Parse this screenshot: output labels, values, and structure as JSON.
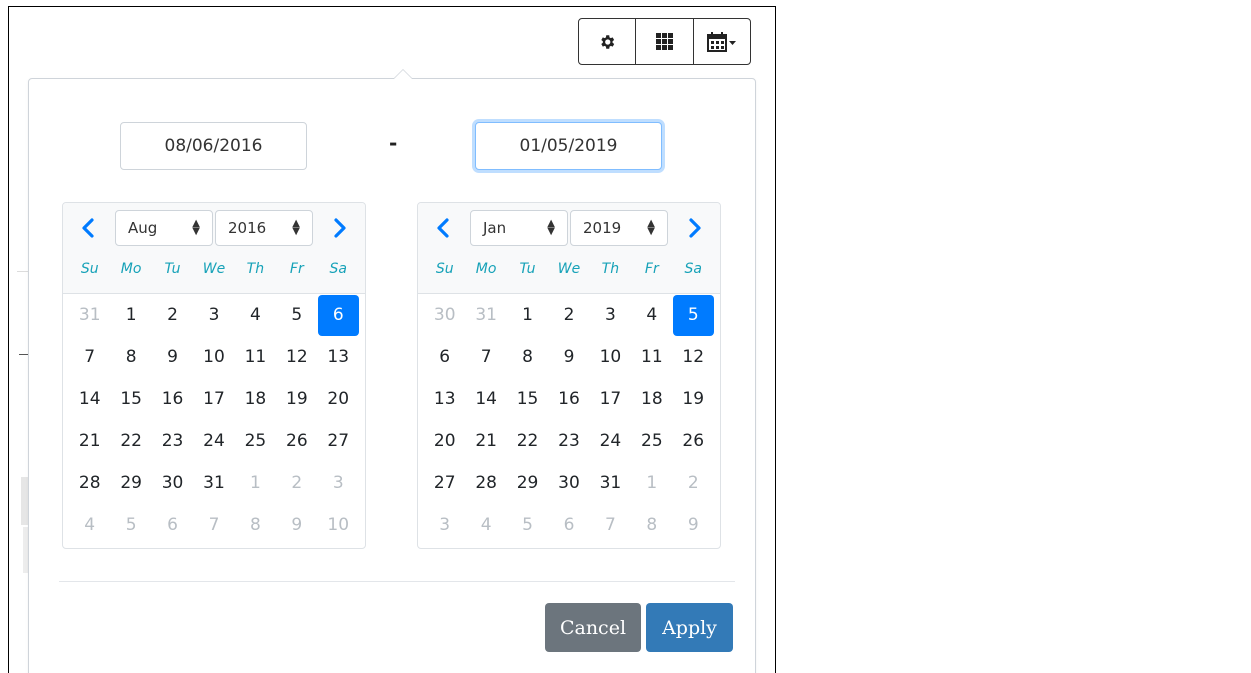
{
  "toolbar": {
    "icons": [
      "gear-icon",
      "grid-icon",
      "calendar-dropdown-icon"
    ]
  },
  "range": {
    "start_value": "08/06/2016",
    "separator": "-",
    "end_value": "01/05/2019"
  },
  "weekdays": [
    "Su",
    "Mo",
    "Tu",
    "We",
    "Th",
    "Fr",
    "Sa"
  ],
  "left_calendar": {
    "month": "Aug",
    "year": "2016",
    "weeks": [
      [
        "31",
        "1",
        "2",
        "3",
        "4",
        "5",
        "6"
      ],
      [
        "7",
        "8",
        "9",
        "10",
        "11",
        "12",
        "13"
      ],
      [
        "14",
        "15",
        "16",
        "17",
        "18",
        "19",
        "20"
      ],
      [
        "21",
        "22",
        "23",
        "24",
        "25",
        "26",
        "27"
      ],
      [
        "28",
        "29",
        "30",
        "31",
        "1",
        "2",
        "3"
      ],
      [
        "4",
        "5",
        "6",
        "7",
        "8",
        "9",
        "10"
      ]
    ],
    "muted": [
      [
        0,
        0
      ],
      [
        4,
        4
      ],
      [
        4,
        5
      ],
      [
        4,
        6
      ],
      [
        5,
        0
      ],
      [
        5,
        1
      ],
      [
        5,
        2
      ],
      [
        5,
        3
      ],
      [
        5,
        4
      ],
      [
        5,
        5
      ],
      [
        5,
        6
      ]
    ],
    "selected": [
      0,
      6
    ]
  },
  "right_calendar": {
    "month": "Jan",
    "year": "2019",
    "weeks": [
      [
        "30",
        "31",
        "1",
        "2",
        "3",
        "4",
        "5"
      ],
      [
        "6",
        "7",
        "8",
        "9",
        "10",
        "11",
        "12"
      ],
      [
        "13",
        "14",
        "15",
        "16",
        "17",
        "18",
        "19"
      ],
      [
        "20",
        "21",
        "22",
        "23",
        "24",
        "25",
        "26"
      ],
      [
        "27",
        "28",
        "29",
        "30",
        "31",
        "1",
        "2"
      ],
      [
        "3",
        "4",
        "5",
        "6",
        "7",
        "8",
        "9"
      ]
    ],
    "muted": [
      [
        0,
        0
      ],
      [
        0,
        1
      ],
      [
        4,
        5
      ],
      [
        4,
        6
      ],
      [
        5,
        0
      ],
      [
        5,
        1
      ],
      [
        5,
        2
      ],
      [
        5,
        3
      ],
      [
        5,
        4
      ],
      [
        5,
        5
      ],
      [
        5,
        6
      ]
    ],
    "selected": [
      0,
      6
    ]
  },
  "actions": {
    "cancel_label": "Cancel",
    "apply_label": "Apply"
  },
  "colors": {
    "accent": "#007bff",
    "apply": "#337ab7",
    "cancel": "#6c757d",
    "weekday": "#17a2b8",
    "muted_day": "#b8bec4"
  }
}
